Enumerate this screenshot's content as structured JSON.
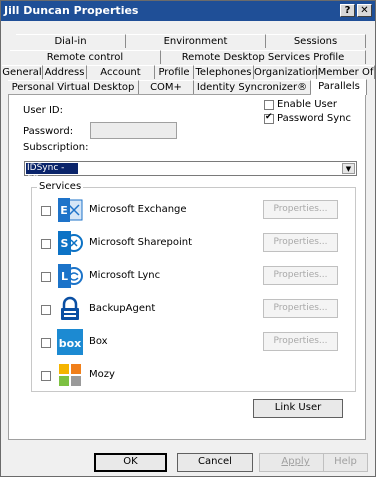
{
  "window": {
    "title": "Jill Duncan Properties",
    "help_glyph": "?",
    "close_glyph": "✕"
  },
  "tabs": {
    "row1": [
      "Dial-in",
      "Environment",
      "Sessions"
    ],
    "row2": [
      "Remote control",
      "Remote Desktop Services Profile"
    ],
    "row3": [
      "General",
      "Address",
      "Account",
      "Profile",
      "Telephones",
      "Organization",
      "Member Of"
    ],
    "row4": [
      "Personal Virtual Desktop",
      "COM+",
      "Identity Syncronizer®",
      "Parallels"
    ],
    "active": "Parallels"
  },
  "parallels": {
    "user_id_label": "User ID:",
    "password_label": "Password:",
    "subscription_label": "Subscription:",
    "enable_user_label": "Enable User",
    "enable_user_checked": false,
    "password_sync_label": "Password Sync",
    "password_sync_checked": true,
    "subscription_value": "IDSync - 68",
    "combo_arrow": "▼"
  },
  "services": {
    "group_label": "Services",
    "items": [
      {
        "name": "Microsoft Exchange",
        "icon": "exchange-icon",
        "properties": "Properties..."
      },
      {
        "name": "Microsoft Sharepoint",
        "icon": "sharepoint-icon",
        "properties": "Properties..."
      },
      {
        "name": "Microsoft Lync",
        "icon": "lync-icon",
        "properties": "Properties..."
      },
      {
        "name": "BackupAgent",
        "icon": "lock-icon",
        "properties": "Properties..."
      },
      {
        "name": "Box",
        "icon": "box-icon",
        "properties": "Properties..."
      },
      {
        "name": "Mozy",
        "icon": "mozy-icon"
      }
    ],
    "link_user": "Link User"
  },
  "footer": {
    "ok": "OK",
    "cancel": "Cancel",
    "apply": "Apply",
    "help": "Help"
  },
  "colors": {
    "titlebar": "#1f4f97",
    "exchange": "#1e73c9",
    "sharepoint": "#0c72c5",
    "lync": "#1b73c9",
    "box": "#1c8ad2"
  }
}
